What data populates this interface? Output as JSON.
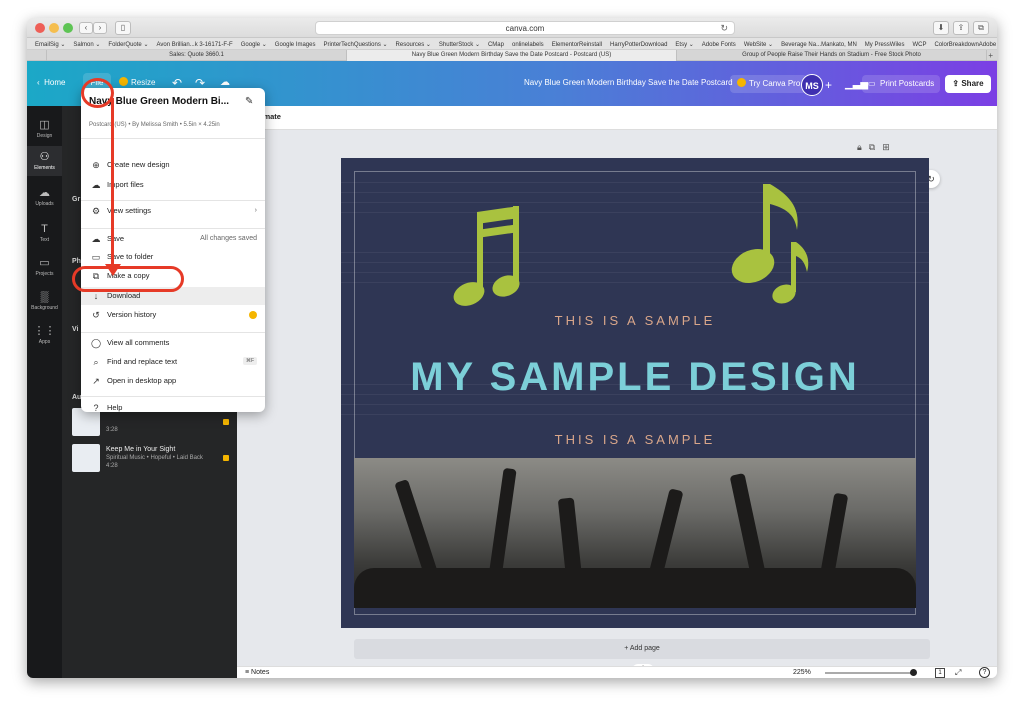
{
  "browser": {
    "url": "canva.com",
    "bookmarks": [
      "EmailSig ⌄",
      "Salmon ⌄",
      "FolderQuote ⌄",
      "Avon Brillian...k 3-16171-F-F",
      "Google ⌄",
      "Google Images",
      "PrinterTechQuestions ⌄",
      "Resources ⌄",
      "ShutterStock ⌄",
      "CMap",
      "onlinelabels",
      "ElementorReinstall",
      "HarryPotterDownload",
      "Etsy ⌄",
      "Adobe Fonts",
      "WebSite ⌄",
      "Beverage Na...Mankato, MN",
      "My PressWiles",
      "WCP",
      "ColorBreakdownAdobe",
      "»"
    ],
    "tabs": [
      "Sales: Quote 3660.1",
      "Navy Blue Green Modern Birthday Save the Date Postcard - Postcard (US)",
      "Group of People Raise Their Hands on Stadium - Free Stock Photo"
    ]
  },
  "header": {
    "home": "Home",
    "file": "File",
    "resize": "Resize",
    "doc_title": "Navy Blue Green Modern Birthday Save the Date Postcard",
    "try_pro": "Try Canva Pro",
    "avatar": "MS",
    "print": "Print Postcards",
    "share": "Share"
  },
  "rail": [
    {
      "icon": "◫",
      "label": "Design"
    },
    {
      "icon": "⚇",
      "label": "Elements"
    },
    {
      "icon": "☁",
      "label": "Uploads"
    },
    {
      "icon": "T",
      "label": "Text"
    },
    {
      "icon": "▭",
      "label": "Projects"
    },
    {
      "icon": "▒",
      "label": "Background"
    },
    {
      "icon": "⋮⋮",
      "label": "Apps"
    }
  ],
  "panel": {
    "stubs": [
      "Gr",
      "Ph",
      "Vi",
      "Au"
    ],
    "audio": [
      {
        "title": "",
        "sub": "",
        "duration": "3:28"
      },
      {
        "title": "Keep Me in Your Sight",
        "sub": "Spiritual Music • Hopeful • Laid Back",
        "duration": "4:28"
      }
    ]
  },
  "menu": {
    "title": "Navy Blue Green Modern Bi...",
    "subtitle": "Postcard (US) • By Melissa Smith • 5.5in × 4.25in",
    "items": [
      {
        "icon": "⊕",
        "label": "Create new design"
      },
      {
        "icon": "☁",
        "label": "Import files"
      },
      {
        "icon": "⚙",
        "label": "View settings",
        "right": "›"
      },
      {
        "icon": "☁",
        "label": "Save",
        "right": "All changes saved"
      },
      {
        "icon": "▭",
        "label": "Save to folder"
      },
      {
        "icon": "⧉",
        "label": "Make a copy"
      },
      {
        "icon": "↓",
        "label": "Download"
      },
      {
        "icon": "↺",
        "label": "Version history"
      },
      {
        "icon": "◯",
        "label": "View all comments"
      },
      {
        "icon": "⌕",
        "label": "Find and replace text",
        "kbd": "⌘F"
      },
      {
        "icon": "↗",
        "label": "Open in desktop app"
      },
      {
        "icon": "?",
        "label": "Help"
      }
    ]
  },
  "editor": {
    "animate": "Animate",
    "sample_top": "THIS IS A SAMPLE",
    "main_title": "MY SAMPLE DESIGN",
    "sample_bottom": "THIS IS A SAMPLE",
    "add_page": "+ Add page",
    "notes": "Notes",
    "zoom": "225%",
    "page_count": "1"
  },
  "colors": {
    "accent_red": "#e63a27",
    "note_green": "#a9c23f",
    "title_teal": "#7ccfd8",
    "sample_peach": "#d9a68a",
    "postcard_navy": "#2f3654"
  }
}
